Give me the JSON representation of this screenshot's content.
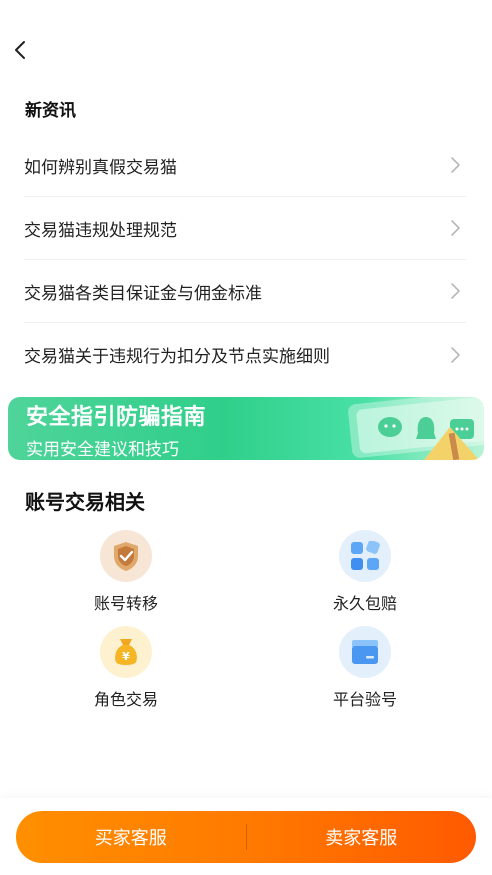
{
  "news": {
    "title": "新资讯",
    "items": [
      {
        "label": "如何辨别真假交易猫"
      },
      {
        "label": "交易猫违规处理规范"
      },
      {
        "label": "交易猫各类目保证金与佣金标准"
      },
      {
        "label": "交易猫关于违规行为扣分及节点实施细则"
      }
    ]
  },
  "banner": {
    "title": "安全指引防骗指南",
    "subtitle": "实用安全建议和技巧"
  },
  "account": {
    "title": "账号交易相关",
    "items": [
      {
        "label": "账号转移",
        "icon": "shield-check-icon"
      },
      {
        "label": "永久包赔",
        "icon": "grid-apps-icon"
      },
      {
        "label": "角色交易",
        "icon": "money-bag-icon"
      },
      {
        "label": "平台验号",
        "icon": "card-box-icon"
      }
    ]
  },
  "bottom": {
    "buyer_label": "买家客服",
    "seller_label": "卖家客服"
  },
  "colors": {
    "accent_orange": "#ff7a00",
    "banner_green": "#2fcf8a"
  }
}
